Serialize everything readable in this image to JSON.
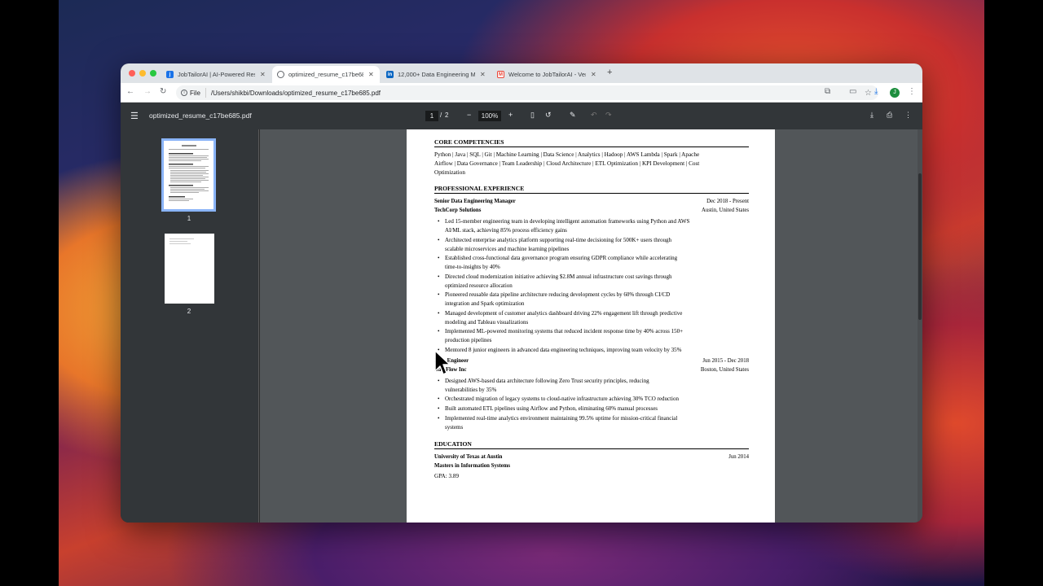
{
  "browser": {
    "tabs": [
      {
        "title": "JobTailorAI | AI-Powered Resu",
        "favicon": "jt"
      },
      {
        "title": "optimized_resume_c17be685.pdf",
        "favicon": "globe"
      },
      {
        "title": "12,000+ Data Engineering Ma",
        "favicon": "in"
      },
      {
        "title": "Welcome to JobTailorAI - Ver",
        "favicon": "gmail"
      }
    ],
    "new_tab": "+",
    "address_chip": "File",
    "url": "/Users/shikbi/Downloads/optimized_resume_c17be685.pdf",
    "profile_initial": "J"
  },
  "pdf_viewer": {
    "filename": "optimized_resume_c17be685.pdf",
    "current_page": "1",
    "separator": "/",
    "total_pages": "2",
    "zoom": "100%",
    "thumbnails": [
      {
        "label": "1"
      },
      {
        "label": "2"
      }
    ]
  },
  "resume": {
    "core": {
      "heading": "CORE COMPETENCIES",
      "lines": [
        "Python | Java | SQL | Git | Machine Learning | Data Science | Analytics | Hadoop | AWS Lambda | Spark | Apache",
        "Airflow | Data Governance | Team Leadership | Cloud Architecture | ETL Optimization | KPI Development | Cost",
        "Optimization"
      ]
    },
    "experience": {
      "heading": "PROFESSIONAL EXPERIENCE",
      "jobs": [
        {
          "title": "Senior Data Engineering Manager",
          "dates": "Dec 2018 - Present",
          "company": "TechCorp Solutions",
          "location": "Austin, United States",
          "bullets": [
            [
              "Led 15-member engineering team in developing intelligent automation frameworks using Python and AWS",
              "AI/ML stack, achieving 85% process efficiency gains"
            ],
            [
              "Architected enterprise analytics platform supporting real-time decisioning for 500K+ users through",
              "scalable microservices and machine learning pipelines"
            ],
            [
              "Established cross-functional data governance program ensuring GDPR compliance while accelerating",
              "time-to-insights by 40%"
            ],
            [
              "Directed cloud modernization initiative achieving $2.8M annual infrastructure cost savings through",
              "optimized resource allocation"
            ],
            [
              "Pioneered reusable data pipeline architecture reducing development cycles by 60% through CI/CD",
              "integration and Spark optimization"
            ],
            [
              "Managed development of customer analytics dashboard driving 22% engagement lift through predictive",
              "modeling and Tableau visualizations"
            ],
            [
              "Implemented ML-powered monitoring systems that reduced incident response time by 40% across 150+",
              "production pipelines"
            ],
            [
              "Mentored 8 junior engineers in advanced data engineering techniques, improving team velocity by 35%",
              ""
            ]
          ]
        },
        {
          "title": "Data Engineer",
          "dates": "Jun 2015 - Dec 2018",
          "company": "DataFlow Inc",
          "location": "Boston, United States",
          "bullets": [
            [
              "Designed AWS-based data architecture following Zero Trust security principles, reducing",
              "vulnerabilities by 35%"
            ],
            [
              "Orchestrated migration of legacy systems to cloud-native infrastructure achieving 30% TCO reduction",
              ""
            ],
            [
              "Built automated ETL pipelines using Airflow and Python, eliminating 60% manual processes",
              ""
            ],
            [
              "Implemented real-time analytics environment maintaining 99.5% uptime for mission-critical financial",
              "systems"
            ]
          ]
        }
      ]
    },
    "education": {
      "heading": "EDUCATION",
      "school": "University of Texas at Austin",
      "date": "Jun 2014",
      "degree": "Masters in Information Systems",
      "gpa": "GPA: 3.89"
    }
  },
  "colors": {
    "tab_strip": "#dfe3e7",
    "pdf_toolbar": "#323639",
    "viewer_bg": "#525659",
    "thumb_selected_border": "#8ab4f8",
    "close": "#ff5f57",
    "minimize": "#febc2e",
    "maximize": "#28c840"
  }
}
